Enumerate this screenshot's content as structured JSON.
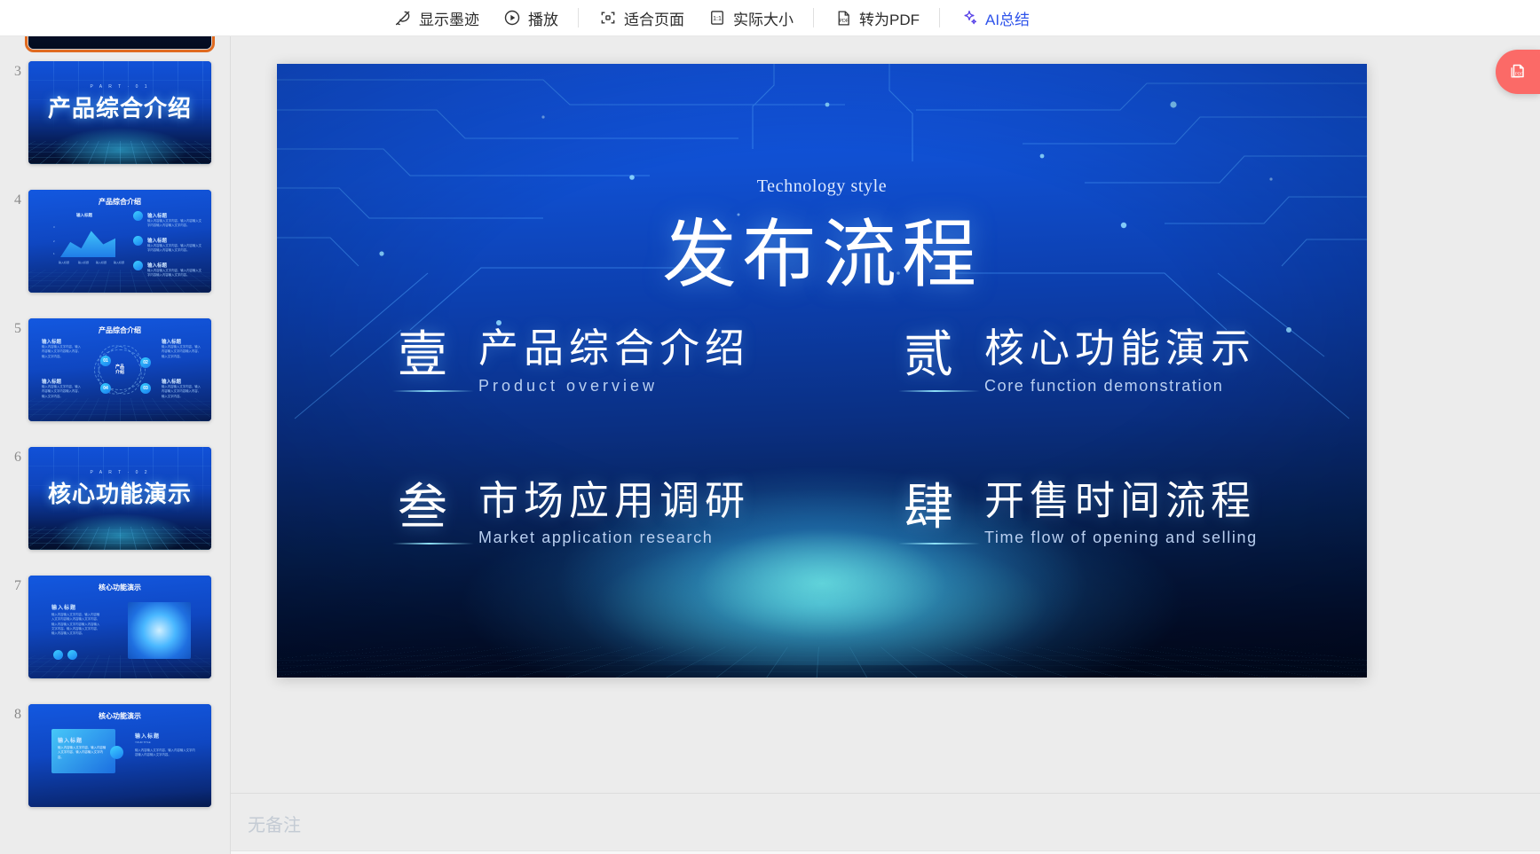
{
  "toolbar": {
    "buttons": [
      {
        "id": "show-ink",
        "label": "显示墨迹",
        "icon": "pen-ink-icon"
      },
      {
        "id": "play",
        "label": "播放",
        "icon": "play-circle-icon"
      },
      {
        "id": "fit-page",
        "label": "适合页面",
        "icon": "fit-page-icon"
      },
      {
        "id": "actual-size",
        "label": "实际大小",
        "icon": "one-to-one-icon"
      },
      {
        "id": "to-pdf",
        "label": "转为PDF",
        "icon": "pdf-file-icon"
      },
      {
        "id": "ai-summary",
        "label": "AI总结",
        "icon": "sparkle-icon",
        "accent": "#2f54eb"
      }
    ]
  },
  "sidebar": {
    "selected_index": 2,
    "slides": [
      {
        "number": "",
        "title": "",
        "kind": "partial-dark",
        "selected": true
      },
      {
        "number": "3",
        "title": "产品综合介绍",
        "part": "P A R T · 0 1",
        "kind": "section-cover"
      },
      {
        "number": "4",
        "title": "产品综合介绍",
        "kind": "chart-slide",
        "label_left": "输入标题",
        "items": [
          {
            "label": "输入标题",
            "body": "输入内容输入文字内容，输入内容输入文字内容输入内容输入文字内容。"
          },
          {
            "label": "输入标题",
            "body": "输入内容输入文字内容，输入内容输入文字内容输入内容输入文字内容。"
          },
          {
            "label": "输入标题",
            "body": "输入内容输入文字内容，输入内容输入文字内容输入内容输入文字内容。"
          }
        ],
        "axis": [
          "输入标题",
          "输入标题",
          "输入标题",
          "输入标题"
        ]
      },
      {
        "number": "5",
        "title": "产品综合介绍",
        "kind": "orbit-slide",
        "center": "产品\n介绍",
        "nodes": [
          "01",
          "02",
          "03",
          "04"
        ],
        "items": [
          {
            "label": "输入标题",
            "body": "输入内容输入文字内容，输入内容输入文字内容输入内容，输入文字内容。"
          },
          {
            "label": "输入标题",
            "body": "输入内容输入文字内容，输入内容输入文字内容输入内容，输入文字内容。"
          },
          {
            "label": "输入标题",
            "body": "输入内容输入文字内容，输入内容输入文字内容输入内容，输入文字内容。"
          },
          {
            "label": "输入标题",
            "body": "输入内容输入文字内容，输入内容输入文字内容输入内容，输入文字内容。"
          }
        ]
      },
      {
        "number": "6",
        "title": "核心功能演示",
        "part": "P A R T · 0 2",
        "kind": "section-cover"
      },
      {
        "number": "7",
        "title": "核心功能演示",
        "kind": "image-slide",
        "label": "输入标题",
        "body": "输入内容输入文字内容，输入内容输入文字内容输入内容输入文字内容，输入内容输入文字内容输入内容输入文字内容。输入内容输入文字内容，输入内容输入文字内容。"
      },
      {
        "number": "8",
        "title": "核心功能演示",
        "kind": "card-slide",
        "card_label": "输入标题",
        "card_body": "输入内容输入文字内容，输入内容输入文字内容，输入内容输入文字内容。",
        "right_label": "输入标题",
        "right_sub": "YOUR TITLE",
        "right_body": "输入内容输入文字内容，输入内容输入文字内容输入内容输入文字内容。"
      }
    ]
  },
  "slide": {
    "eyebrow": "Technology style",
    "title": "发布流程",
    "items": [
      {
        "num": "壹",
        "cn": "产品综合介绍",
        "en": "Product  overview"
      },
      {
        "num": "贰",
        "cn": "核心功能演示",
        "en": "Core function demonstration"
      },
      {
        "num": "叁",
        "cn": "市场应用调研",
        "en": "Market application research"
      },
      {
        "num": "肆",
        "cn": "开售时间流程",
        "en": "Time flow of opening and selling"
      }
    ]
  },
  "notes": {
    "placeholder": "无备注"
  },
  "fab": {
    "name": "export-pdf-fab",
    "icon": "pdf-pages-icon",
    "color": "#fb6a67"
  }
}
